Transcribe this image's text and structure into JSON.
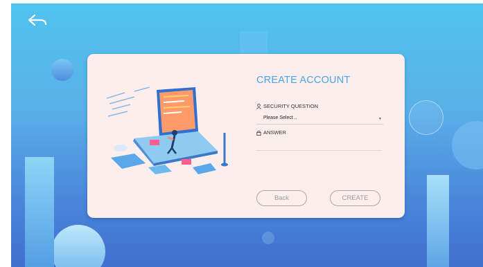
{
  "header": {
    "back_icon": "back-arrow-icon"
  },
  "form": {
    "title": "CREATE ACCOUNT",
    "security_question_label": "SECURITY QUESTION",
    "security_question_icon": "user-icon",
    "security_question_value": "Please Select ..",
    "answer_label": "ANSWER",
    "answer_icon": "lock-icon",
    "answer_value": "",
    "back_label": "Back",
    "create_label": "CREATE"
  },
  "colors": {
    "accent": "#4ba4e4",
    "card_bg": "#fbeeed",
    "bg_top": "#4fc3ee",
    "bg_bottom": "#3f6fcf"
  }
}
